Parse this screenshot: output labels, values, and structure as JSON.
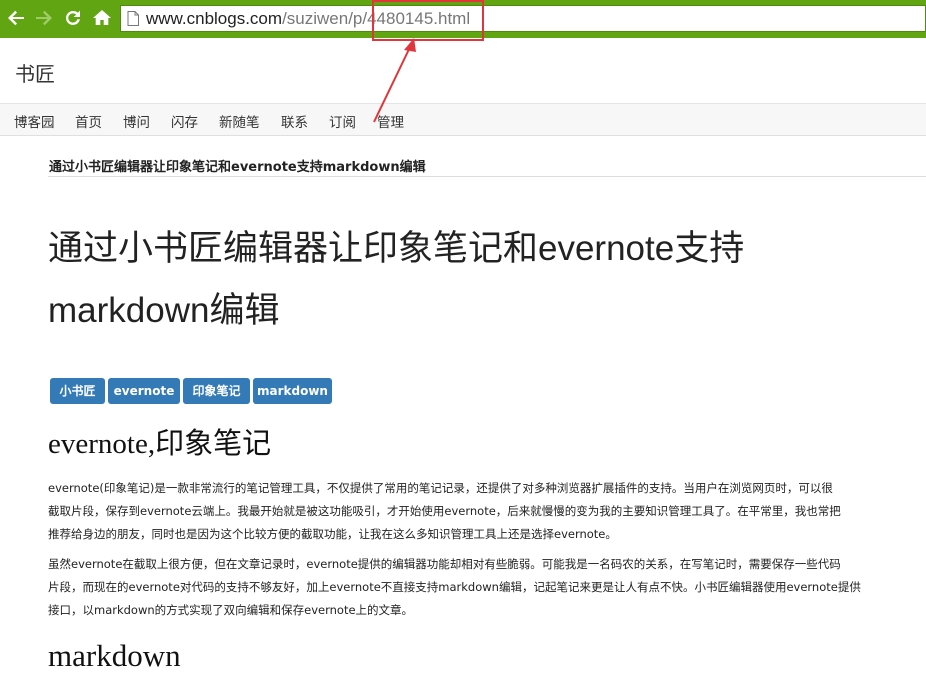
{
  "browser": {
    "url_domain": "www.cnblogs.com",
    "url_path": "/suziwen/p/4480145.html",
    "toolbar_color": "#62a512"
  },
  "icons": [
    "back-arrow-icon",
    "forward-arrow-icon",
    "reload-icon",
    "home-icon",
    "page-icon"
  ],
  "blog": {
    "title": "书匠",
    "nav": [
      "博客园",
      "首页",
      "博问",
      "闪存",
      "新随笔",
      "联系",
      "订阅",
      "管理"
    ]
  },
  "post": {
    "crumb_title": "通过小书匠编辑器让印象笔记和evernote支持markdown编辑",
    "title_line1": "通过小书匠编辑器让印象笔记和evernote支持",
    "title_line2": "markdown编辑",
    "tags": [
      "小书匠",
      "evernote",
      "印象笔记",
      "markdown"
    ],
    "tag_color": "#337ab7",
    "section1_heading": "evernote,印象笔记",
    "para1_lines": [
      "evernote(印象笔记)是一款非常流行的笔记管理工具，不仅提供了常用的笔记记录，还提供了对多种浏览器扩展插件的支持。当用户在浏览网页时，可以很",
      "截取片段，保存到evernote云端上。我最开始就是被这功能吸引，才开始使用evernote，后来就慢慢的变为我的主要知识管理工具了。在平常里，我也常把",
      "推荐给身边的朋友，同时也是因为这个比较方便的截取功能，让我在这么多知识管理工具上还是选择evernote。"
    ],
    "para2_lines": [
      "虽然evernote在截取上很方便，但在文章记录时，evernote提供的编辑器功能却相对有些脆弱。可能我是一名码农的关系，在写笔记时，需要保存一些代码",
      "片段，而现在的evernote对代码的支持不够友好，加上evernote不直接支持markdown编辑，记起笔记来更是让人有点不快。小书匠编辑器使用evernote提供",
      "接口，以markdown的方式实现了双向编辑和保存evernote上的文章。"
    ],
    "section2_heading": "markdown"
  },
  "annotation": {
    "color": "#e0353a"
  }
}
